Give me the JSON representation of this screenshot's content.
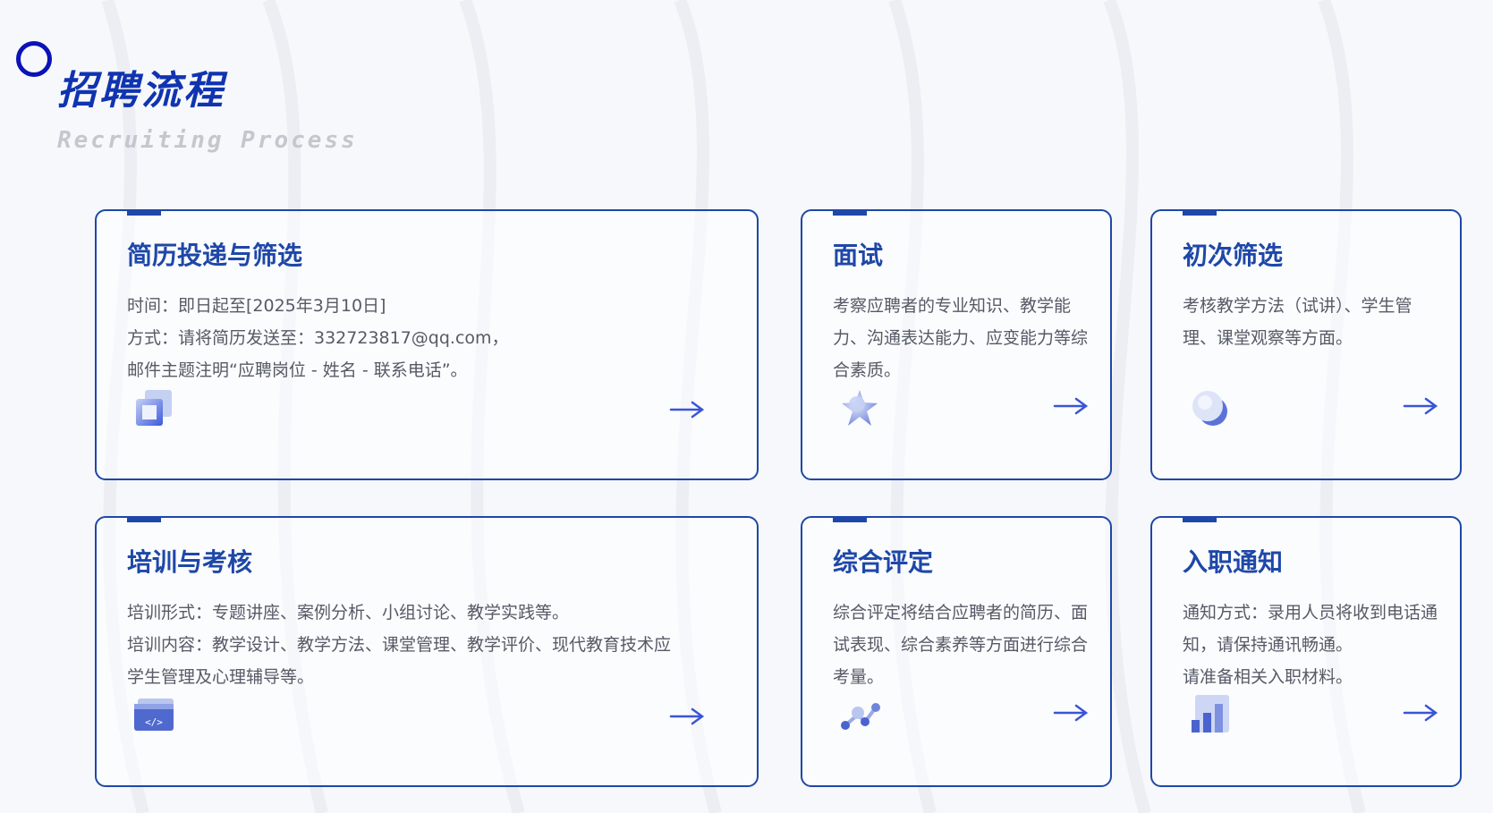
{
  "header": {
    "title": "招聘流程",
    "subtitle": "Recruiting Process"
  },
  "colors": {
    "accent": "#1e47a8",
    "title": "#1034b0",
    "ring": "#0a12b8",
    "text": "#555a66",
    "subtitle": "#c5c7cf"
  },
  "cards": [
    {
      "title": "简历投递与筛选",
      "icon": "layers-icon",
      "lines": [
        "时间：即日起至[2025年3月10日]",
        "方式：请将简历发送至：332723817@qq.com，",
        "邮件主题注明“应聘岗位 - 姓名 - 联系电话”。"
      ]
    },
    {
      "title": "面试",
      "icon": "star-icon",
      "lines": [
        "考察应聘者的专业知识、教学能力、沟通表达能力、应变能力等综合素质。"
      ]
    },
    {
      "title": "初次筛选",
      "icon": "moon-icon",
      "lines": [
        "考核教学方法（试讲）、学生管理、课堂观察等方面。"
      ]
    },
    {
      "title": "培训与考核",
      "icon": "code-window-icon",
      "lines": [
        "培训形式：专题讲座、案例分析、小组讨论、教学实践等。",
        "培训内容：教学设计、教学方法、课堂管理、教学评价、现代教育技术应",
        "学生管理及心理辅导等。"
      ]
    },
    {
      "title": "综合评定",
      "icon": "network-nodes-icon",
      "lines": [
        "综合评定将结合应聘者的简历、面试表现、综合素养等方面进行综合考量。"
      ]
    },
    {
      "title": "入职通知",
      "icon": "bar-chart-icon",
      "lines": [
        "通知方式：录用人员将收到电话通知，请保持通讯畅通。",
        "请准备相关入职材料。"
      ]
    }
  ]
}
